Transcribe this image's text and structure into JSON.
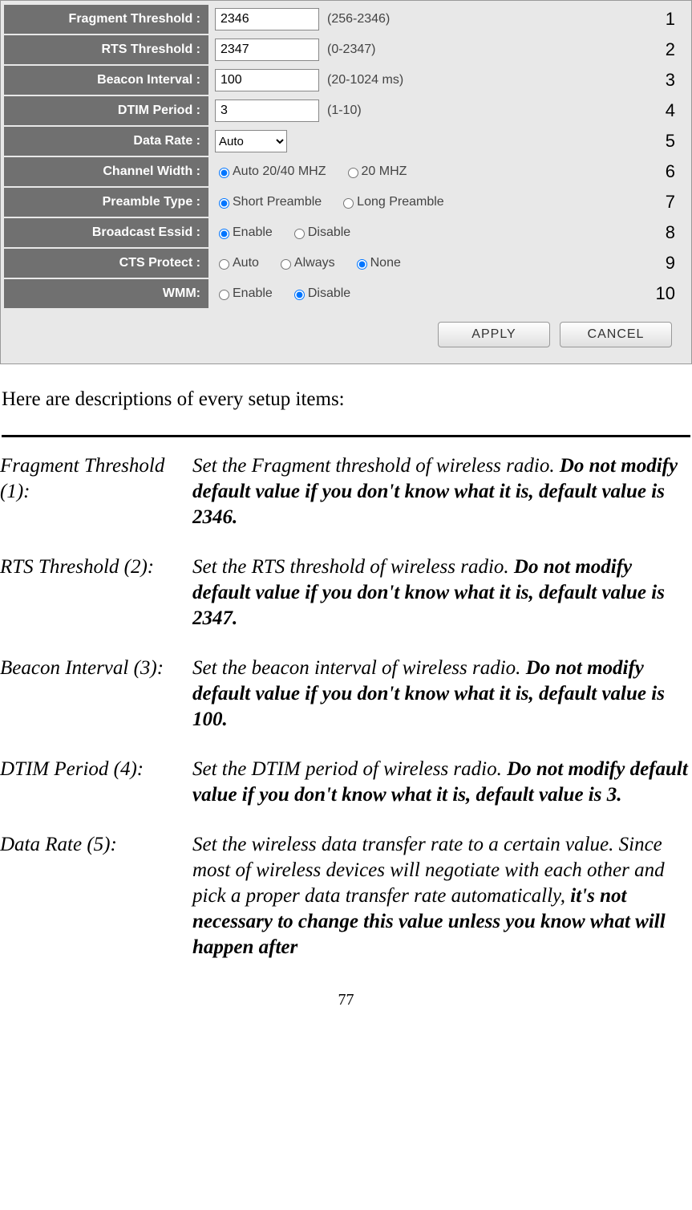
{
  "form": {
    "rows": [
      {
        "num": "1",
        "label": "Fragment Threshold :",
        "type": "text",
        "value": "2346",
        "hint": "(256-2346)"
      },
      {
        "num": "2",
        "label": "RTS Threshold :",
        "type": "text",
        "value": "2347",
        "hint": "(0-2347)"
      },
      {
        "num": "3",
        "label": "Beacon Interval :",
        "type": "text",
        "value": "100",
        "hint": "(20-1024 ms)"
      },
      {
        "num": "4",
        "label": "DTIM Period :",
        "type": "text",
        "value": "3",
        "hint": "(1-10)"
      },
      {
        "num": "5",
        "label": "Data Rate :",
        "type": "select",
        "value": "Auto"
      },
      {
        "num": "6",
        "label": "Channel Width :",
        "type": "radio",
        "options": [
          {
            "label": "Auto 20/40 MHZ",
            "checked": true
          },
          {
            "label": "20 MHZ",
            "checked": false
          }
        ]
      },
      {
        "num": "7",
        "label": "Preamble Type :",
        "type": "radio",
        "options": [
          {
            "label": "Short Preamble",
            "checked": true
          },
          {
            "label": "Long Preamble",
            "checked": false
          }
        ]
      },
      {
        "num": "8",
        "label": "Broadcast Essid :",
        "type": "radio",
        "options": [
          {
            "label": "Enable",
            "checked": true
          },
          {
            "label": "Disable",
            "checked": false
          }
        ]
      },
      {
        "num": "9",
        "label": "CTS Protect :",
        "type": "radio",
        "options": [
          {
            "label": "Auto",
            "checked": false
          },
          {
            "label": "Always",
            "checked": false
          },
          {
            "label": "None",
            "checked": true
          }
        ]
      },
      {
        "num": "10",
        "label": "WMM:",
        "type": "radio",
        "options": [
          {
            "label": "Enable",
            "checked": false
          },
          {
            "label": "Disable",
            "checked": true
          }
        ]
      }
    ],
    "buttons": {
      "apply": "APPLY",
      "cancel": "CANCEL"
    }
  },
  "intro": "Here are descriptions of every setup items:",
  "descriptions": [
    {
      "term": "Fragment Threshold (1):",
      "plain": "Set the Fragment threshold of wireless radio. ",
      "bold": "Do not modify default value if you don't know what it is, default value is 2346."
    },
    {
      "term": "RTS Threshold (2):",
      "plain": "Set the RTS threshold of wireless radio. ",
      "bold": "Do not modify default value if you don't know what it is, default value is 2347."
    },
    {
      "term": "Beacon Interval (3):",
      "plain": "Set the beacon interval of wireless radio. ",
      "bold": "Do not modify default value if you don't know what it is, default value is 100."
    },
    {
      "term": "DTIM Period (4):",
      "plain": "Set the DTIM period of wireless radio. ",
      "bold": "Do not modify default value if you don't know what it is, default value is 3."
    },
    {
      "term": "Data Rate (5):",
      "plain": "Set the wireless data transfer rate to a certain value. Since most of wireless devices will negotiate with each other and pick a proper data transfer rate automatically, ",
      "bold": "it's not necessary to change this value unless you know what will happen after"
    }
  ],
  "page_number": "77"
}
